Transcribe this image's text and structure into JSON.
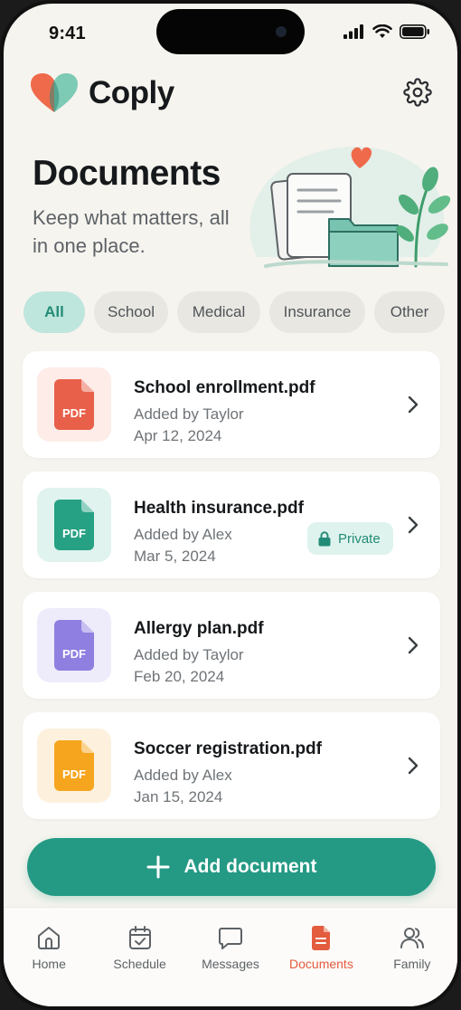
{
  "status": {
    "time": "9:41"
  },
  "brand": {
    "name": "Coply"
  },
  "hero": {
    "title": "Documents",
    "subtitle": "Keep what matters, all in one place."
  },
  "filters": [
    {
      "label": "All",
      "active": true
    },
    {
      "label": "School",
      "active": false
    },
    {
      "label": "Medical",
      "active": false
    },
    {
      "label": "Insurance",
      "active": false
    },
    {
      "label": "Other",
      "active": false
    }
  ],
  "documents": [
    {
      "name": "School enrollment.pdf",
      "added_by": "Added by Taylor",
      "date": "Apr 12, 2024",
      "icon_color": "#e8604a",
      "thumb_bg": "#fdece7",
      "badge": null
    },
    {
      "name": "Health insurance.pdf",
      "added_by": "Added by Alex",
      "date": "Mar 5, 2024",
      "icon_color": "#27a184",
      "thumb_bg": "#e0f3ee",
      "badge": "Private"
    },
    {
      "name": "Allergy plan.pdf",
      "added_by": "Added by Taylor",
      "date": "Feb 20, 2024",
      "icon_color": "#8e7fe0",
      "thumb_bg": "#eeebfb",
      "badge": null
    },
    {
      "name": "Soccer registration.pdf",
      "added_by": "Added by Alex",
      "date": "Jan 15, 2024",
      "icon_color": "#f6a51e",
      "thumb_bg": "#fdf1dd",
      "badge": null
    }
  ],
  "pdf_label": "PDF",
  "add_button": {
    "label": "Add document"
  },
  "tabs": [
    {
      "label": "Home",
      "icon": "home-icon",
      "active": false
    },
    {
      "label": "Schedule",
      "icon": "calendar-icon",
      "active": false
    },
    {
      "label": "Messages",
      "icon": "chat-icon",
      "active": false
    },
    {
      "label": "Documents",
      "icon": "document-icon",
      "active": true
    },
    {
      "label": "Family",
      "icon": "family-icon",
      "active": false
    }
  ],
  "colors": {
    "accent": "#249a84",
    "active_tab": "#e45c3e",
    "background": "#f6f4ef"
  }
}
